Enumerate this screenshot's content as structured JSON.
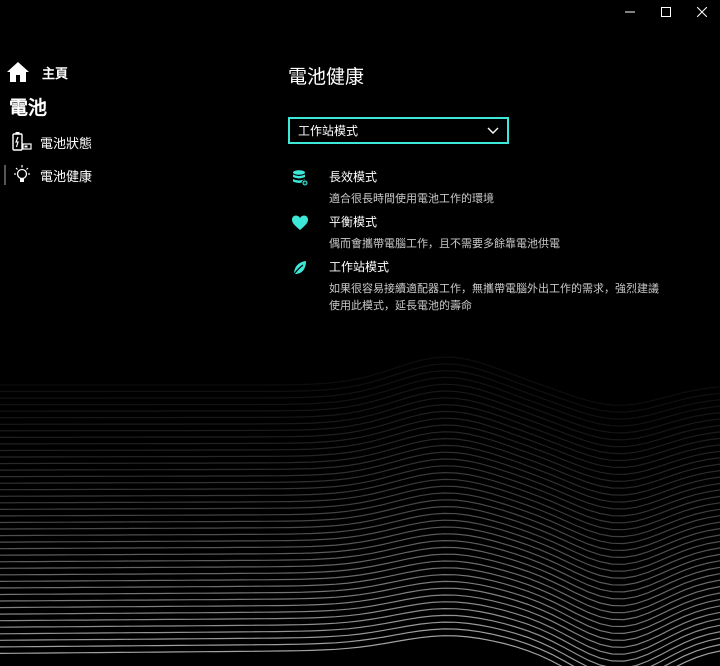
{
  "window": {
    "controls": [
      "minimize",
      "maximize",
      "close"
    ]
  },
  "sidebar": {
    "home_label": "主頁",
    "section_title": "電池",
    "items": [
      {
        "label": "電池狀態",
        "icon": "battery-status-icon",
        "active": false
      },
      {
        "label": "電池健康",
        "icon": "lightbulb-icon",
        "active": true
      }
    ]
  },
  "main": {
    "title": "電池健康",
    "mode_select": {
      "selected": "工作站模式"
    },
    "modes": [
      {
        "name": "長效模式",
        "icon": "database-icon",
        "description": "適合很長時間使用電池工作的環境"
      },
      {
        "name": "平衡模式",
        "icon": "heart-icon",
        "description": "偶而會攜帶電腦工作，且不需要多餘靠電池供電"
      },
      {
        "name": "工作站模式",
        "icon": "leaf-icon",
        "description": "如果很容易接續適配器工作，無攜帶電腦外出工作的需求，強烈建議使用此模式，延長電池的壽命"
      }
    ]
  },
  "colors": {
    "accent": "#3ee8d8",
    "background": "#000000",
    "text": "#ffffff",
    "secondary_text": "#c9c9c9"
  }
}
